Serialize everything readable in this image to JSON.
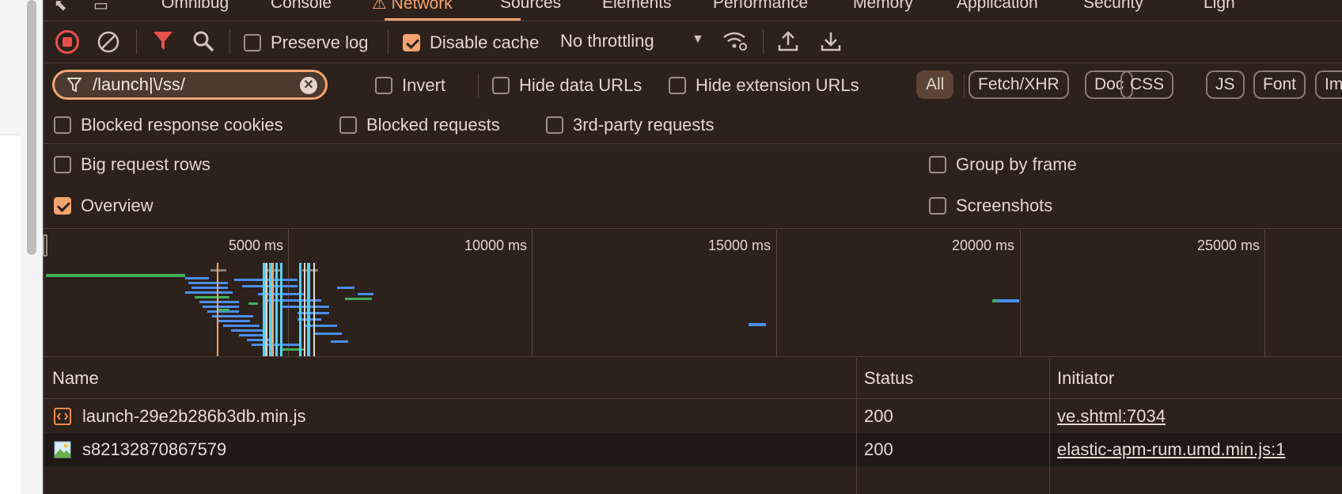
{
  "tabs": [
    "Omnibug",
    "Console",
    "Network",
    "Sources",
    "Elements",
    "Performance",
    "Memory",
    "Application",
    "Security",
    "Ligh"
  ],
  "toolbar": {
    "preserve_log": "Preserve log",
    "disable_cache": "Disable cache",
    "throttling": "No throttling"
  },
  "filter": {
    "value": "/launch|\\/ss/",
    "invert": "Invert",
    "hide_data_urls": "Hide data URLs",
    "hide_extension_urls": "Hide extension URLs",
    "types": [
      "All",
      "Fetch/XHR",
      "Doc",
      "CSS",
      "JS",
      "Font",
      "Im"
    ]
  },
  "row3": {
    "blocked_cookies": "Blocked response cookies",
    "blocked_requests": "Blocked requests",
    "third_party": "3rd-party requests"
  },
  "settings": {
    "big_rows": "Big request rows",
    "group_by_frame": "Group by frame",
    "overview": "Overview",
    "screenshots": "Screenshots"
  },
  "overview": {
    "ticks": [
      "5000 ms",
      "10000 ms",
      "15000 ms",
      "20000 ms",
      "25000 ms"
    ]
  },
  "table": {
    "headers": {
      "name": "Name",
      "status": "Status",
      "initiator": "Initiator"
    },
    "rows": [
      {
        "name": "launch-29e2b286b3db.min.js",
        "status": "200",
        "initiator": "ve.shtml:7034",
        "type": "script"
      },
      {
        "name": "s82132870867579",
        "status": "200",
        "initiator": "elastic-apm-rum.umd.min.js:1",
        "type": "image"
      }
    ]
  },
  "colors": {
    "accent": "#f5a470",
    "record": "#e8514c",
    "blue": "#4a8ef0",
    "green": "#3fb15a",
    "cyan": "#5ad0f0"
  }
}
